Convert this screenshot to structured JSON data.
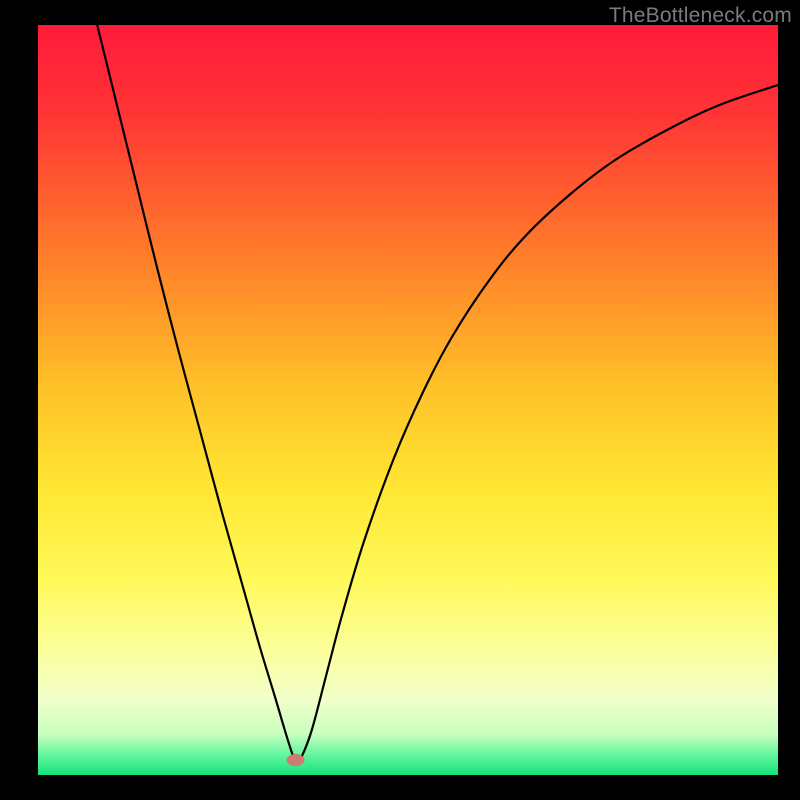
{
  "attribution": "TheBottleneck.com",
  "chart_data": {
    "type": "line",
    "xlabel": "",
    "ylabel": "",
    "xlim": [
      0,
      100
    ],
    "ylim": [
      0,
      100
    ],
    "title": "",
    "grid": false,
    "background_gradient": {
      "stops": [
        {
          "offset": 0.0,
          "color": "#ff1a3a"
        },
        {
          "offset": 0.12,
          "color": "#ff3535"
        },
        {
          "offset": 0.3,
          "color": "#ff7a2a"
        },
        {
          "offset": 0.48,
          "color": "#ffc028"
        },
        {
          "offset": 0.62,
          "color": "#ffe733"
        },
        {
          "offset": 0.74,
          "color": "#fff95a"
        },
        {
          "offset": 0.84,
          "color": "#fbffa0"
        },
        {
          "offset": 0.9,
          "color": "#f1ffca"
        },
        {
          "offset": 0.945,
          "color": "#c9ffbf"
        },
        {
          "offset": 0.97,
          "color": "#6cf7a1"
        },
        {
          "offset": 1.0,
          "color": "#14e37a"
        }
      ]
    },
    "marker": {
      "x": 34.8,
      "y": 2,
      "color": "#cf7a72"
    },
    "series": [
      {
        "name": "curve",
        "color": "#000000",
        "points": [
          {
            "x": 8.0,
            "y": 100.0
          },
          {
            "x": 10.0,
            "y": 92.0
          },
          {
            "x": 13.0,
            "y": 80.0
          },
          {
            "x": 16.0,
            "y": 68.0
          },
          {
            "x": 19.0,
            "y": 56.5
          },
          {
            "x": 22.0,
            "y": 45.5
          },
          {
            "x": 25.0,
            "y": 34.5
          },
          {
            "x": 28.0,
            "y": 24.0
          },
          {
            "x": 30.0,
            "y": 17.0
          },
          {
            "x": 32.0,
            "y": 10.5
          },
          {
            "x": 33.5,
            "y": 5.5
          },
          {
            "x": 34.6,
            "y": 2.2
          },
          {
            "x": 35.0,
            "y": 2.0
          },
          {
            "x": 35.6,
            "y": 2.4
          },
          {
            "x": 37.0,
            "y": 6.0
          },
          {
            "x": 39.0,
            "y": 13.5
          },
          {
            "x": 41.0,
            "y": 21.0
          },
          {
            "x": 44.0,
            "y": 31.0
          },
          {
            "x": 48.0,
            "y": 42.0
          },
          {
            "x": 52.0,
            "y": 51.0
          },
          {
            "x": 56.0,
            "y": 58.5
          },
          {
            "x": 61.0,
            "y": 66.0
          },
          {
            "x": 66.0,
            "y": 72.0
          },
          {
            "x": 72.0,
            "y": 77.5
          },
          {
            "x": 78.0,
            "y": 82.0
          },
          {
            "x": 85.0,
            "y": 86.0
          },
          {
            "x": 92.0,
            "y": 89.3
          },
          {
            "x": 100.0,
            "y": 92.0
          }
        ]
      }
    ]
  }
}
